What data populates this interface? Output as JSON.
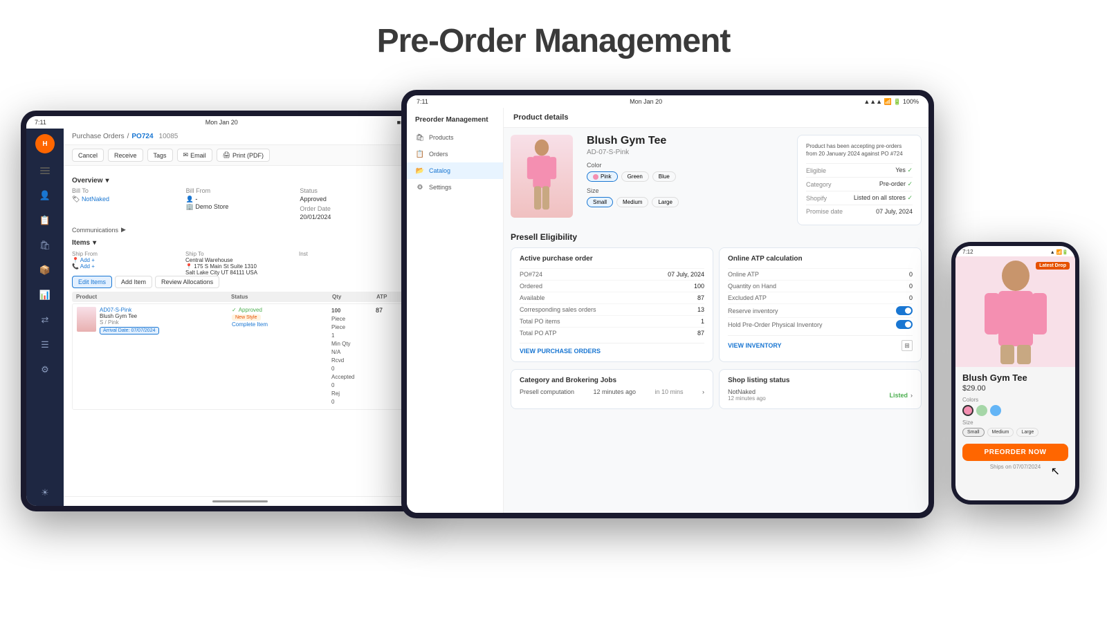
{
  "page": {
    "title": "Pre-Order Management"
  },
  "tablet_left": {
    "status_bar": {
      "time": "7:11",
      "date": "Mon Jan 20"
    },
    "breadcrumb": {
      "section": "Purchase Orders",
      "current": "PO724",
      "id": "10085"
    },
    "toolbar": {
      "cancel": "Cancel",
      "receive": "Receive",
      "tags": "Tags",
      "email": "Email",
      "print": "Print (PDF)"
    },
    "overview": {
      "label": "Overview",
      "bill_to_label": "Bill To",
      "bill_to_val": "NotNaked",
      "bill_from_label": "Bill From",
      "bill_from_val": "Demo Store",
      "status_label": "Status",
      "status_val": "Approved",
      "order_date_label": "Order Date",
      "order_date_val": "20/01/2024"
    },
    "communications": "Communications",
    "items": {
      "label": "Items",
      "edit_btn": "Edit Items",
      "add_btn": "Add Item",
      "review_btn": "Review Allocations",
      "ship_from_label": "Ship From",
      "ship_to_label": "Ship To",
      "ship_to_val": "Central Warehouse",
      "ship_to_addr": "175 S Main St Suite 1310",
      "ship_to_city": "Salt Lake City UT 84111 USA",
      "inst_label": "Inst",
      "add_label": "Add",
      "columns": {
        "product": "Product",
        "status": "Status",
        "qty": "Qty",
        "atp": "ATP"
      },
      "row": {
        "sku": "AD07-S-Pink",
        "name": "Blush Gym Tee",
        "variant": "S / Pink",
        "arrival": "Arrival Date: 07/07/2024",
        "status": "Approved",
        "new_style": "New Style",
        "complete": "Complete Item",
        "qty": "100",
        "unit": "Piece",
        "atp": "87",
        "piece_label": "Piece",
        "piece_val": "1",
        "min_qty_label": "Min Qty",
        "min_qty_val": "N/A",
        "rcvd_label": "Rcvd",
        "rcvd_val": "0",
        "accepted_label": "Accepted",
        "accepted_val": "0",
        "rej_label": "Rej",
        "rej_val": "0"
      }
    }
  },
  "tablet_right": {
    "status_bar": {
      "time": "7:11",
      "date": "Mon Jan 20"
    },
    "nav": {
      "title": "Preorder Management",
      "items": [
        {
          "label": "Products",
          "icon": "🛍"
        },
        {
          "label": "Orders",
          "icon": "📋"
        },
        {
          "label": "Catalog",
          "icon": "📂"
        },
        {
          "label": "Settings",
          "icon": "⚙"
        }
      ]
    },
    "product_details": {
      "header": "Product details",
      "name": "Blush Gym Tee",
      "sku": "AD-07-S-Pink",
      "color_label": "Color",
      "colors": [
        "Pink",
        "Green",
        "Blue"
      ],
      "active_color": "Pink",
      "size_label": "Size",
      "sizes": [
        "Small",
        "Medium",
        "Large"
      ],
      "active_size": "Small",
      "info_card": {
        "note": "Product has been accepting pre-orders from 20 January 2024 against PO #724",
        "eligible_label": "Eligible",
        "eligible_val": "Yes",
        "category_label": "Category",
        "category_val": "Pre-order",
        "shopify_label": "Shopify",
        "shopify_val": "Listed on all stores",
        "promise_label": "Promise date",
        "promise_val": "07 July, 2024"
      }
    },
    "presell": {
      "title": "Presell Eligibility",
      "purchase_order": {
        "title": "Active purchase order",
        "po_label": "PO#724",
        "po_date": "07 July, 2024",
        "ordered_label": "Ordered",
        "ordered_val": "100",
        "available_label": "Available",
        "available_val": "87",
        "sales_orders_label": "Corresponding sales orders",
        "sales_orders_val": "13",
        "total_po_items_label": "Total PO items",
        "total_po_items_val": "1",
        "total_po_atp_label": "Total PO ATP",
        "total_po_atp_val": "87",
        "view_link": "VIEW PURCHASE ORDERS"
      },
      "atp": {
        "title": "Online ATP calculation",
        "online_atp_label": "Online ATP",
        "online_atp_val": "0",
        "qty_on_hand_label": "Quantity on Hand",
        "qty_on_hand_val": "0",
        "excluded_atp_label": "Excluded ATP",
        "excluded_atp_val": "0",
        "reserve_label": "Reserve inventory",
        "hold_label": "Hold Pre-Order Physical Inventory",
        "view_inventory_link": "VIEW INVENTORY"
      }
    },
    "category": {
      "brokering_title": "Category and Brokering Jobs",
      "presell_computation_label": "Presell computation",
      "presell_time": "12 minutes ago",
      "presell_in": "in 10 mins",
      "shop_listing_title": "Shop listing status",
      "shop_vendor": "NotNaked",
      "shop_time": "12 minutes ago",
      "shop_status": "Listed"
    }
  },
  "phone": {
    "status_bar": {
      "time": "7:12"
    },
    "product": {
      "badge": "Latest Drop",
      "name": "Blush Gym Tee",
      "price": "$29.00",
      "colors_label": "Colors",
      "colors": [
        {
          "name": "pink",
          "hex": "#f48fb1"
        },
        {
          "name": "green",
          "hex": "#a5d6a7"
        },
        {
          "name": "blue",
          "hex": "#64b5f6"
        }
      ],
      "active_color": "pink",
      "size_label": "Size",
      "sizes": [
        "Small",
        "Medium",
        "Large"
      ],
      "active_size": "Small",
      "preorder_btn": "PREORDER NOW",
      "ships_label": "Ships on 07/07/2024"
    }
  }
}
